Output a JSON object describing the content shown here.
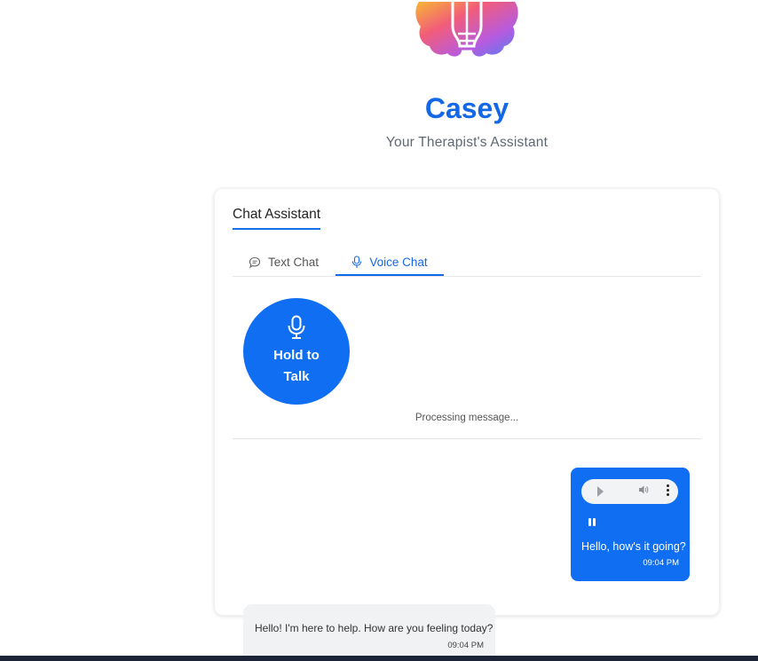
{
  "header": {
    "app_name": "Casey",
    "subtitle": "Your Therapist's Assistant",
    "logo_icon": "brain-lightbulb-icon"
  },
  "card": {
    "title": "Chat Assistant",
    "tabs": [
      {
        "label": "Text Chat",
        "icon": "chat-bubble-icon",
        "active": false
      },
      {
        "label": "Voice Chat",
        "icon": "microphone-icon",
        "active": true
      }
    ],
    "talk_button": {
      "label": "Hold to Talk",
      "icon": "microphone-icon"
    },
    "status": "Processing message..."
  },
  "messages": [
    {
      "sender": "user",
      "text": "Hello, how's it going?",
      "time": "09:04 PM",
      "has_audio": true
    },
    {
      "sender": "assistant",
      "text": "Hello! I'm here to help. How are you feeling today?",
      "time": "09:04 PM"
    }
  ],
  "colors": {
    "accent": "#1468e6",
    "button": "#0f6ef2",
    "bot_bubble": "#f1f2f4",
    "footer": "#1c2537"
  }
}
